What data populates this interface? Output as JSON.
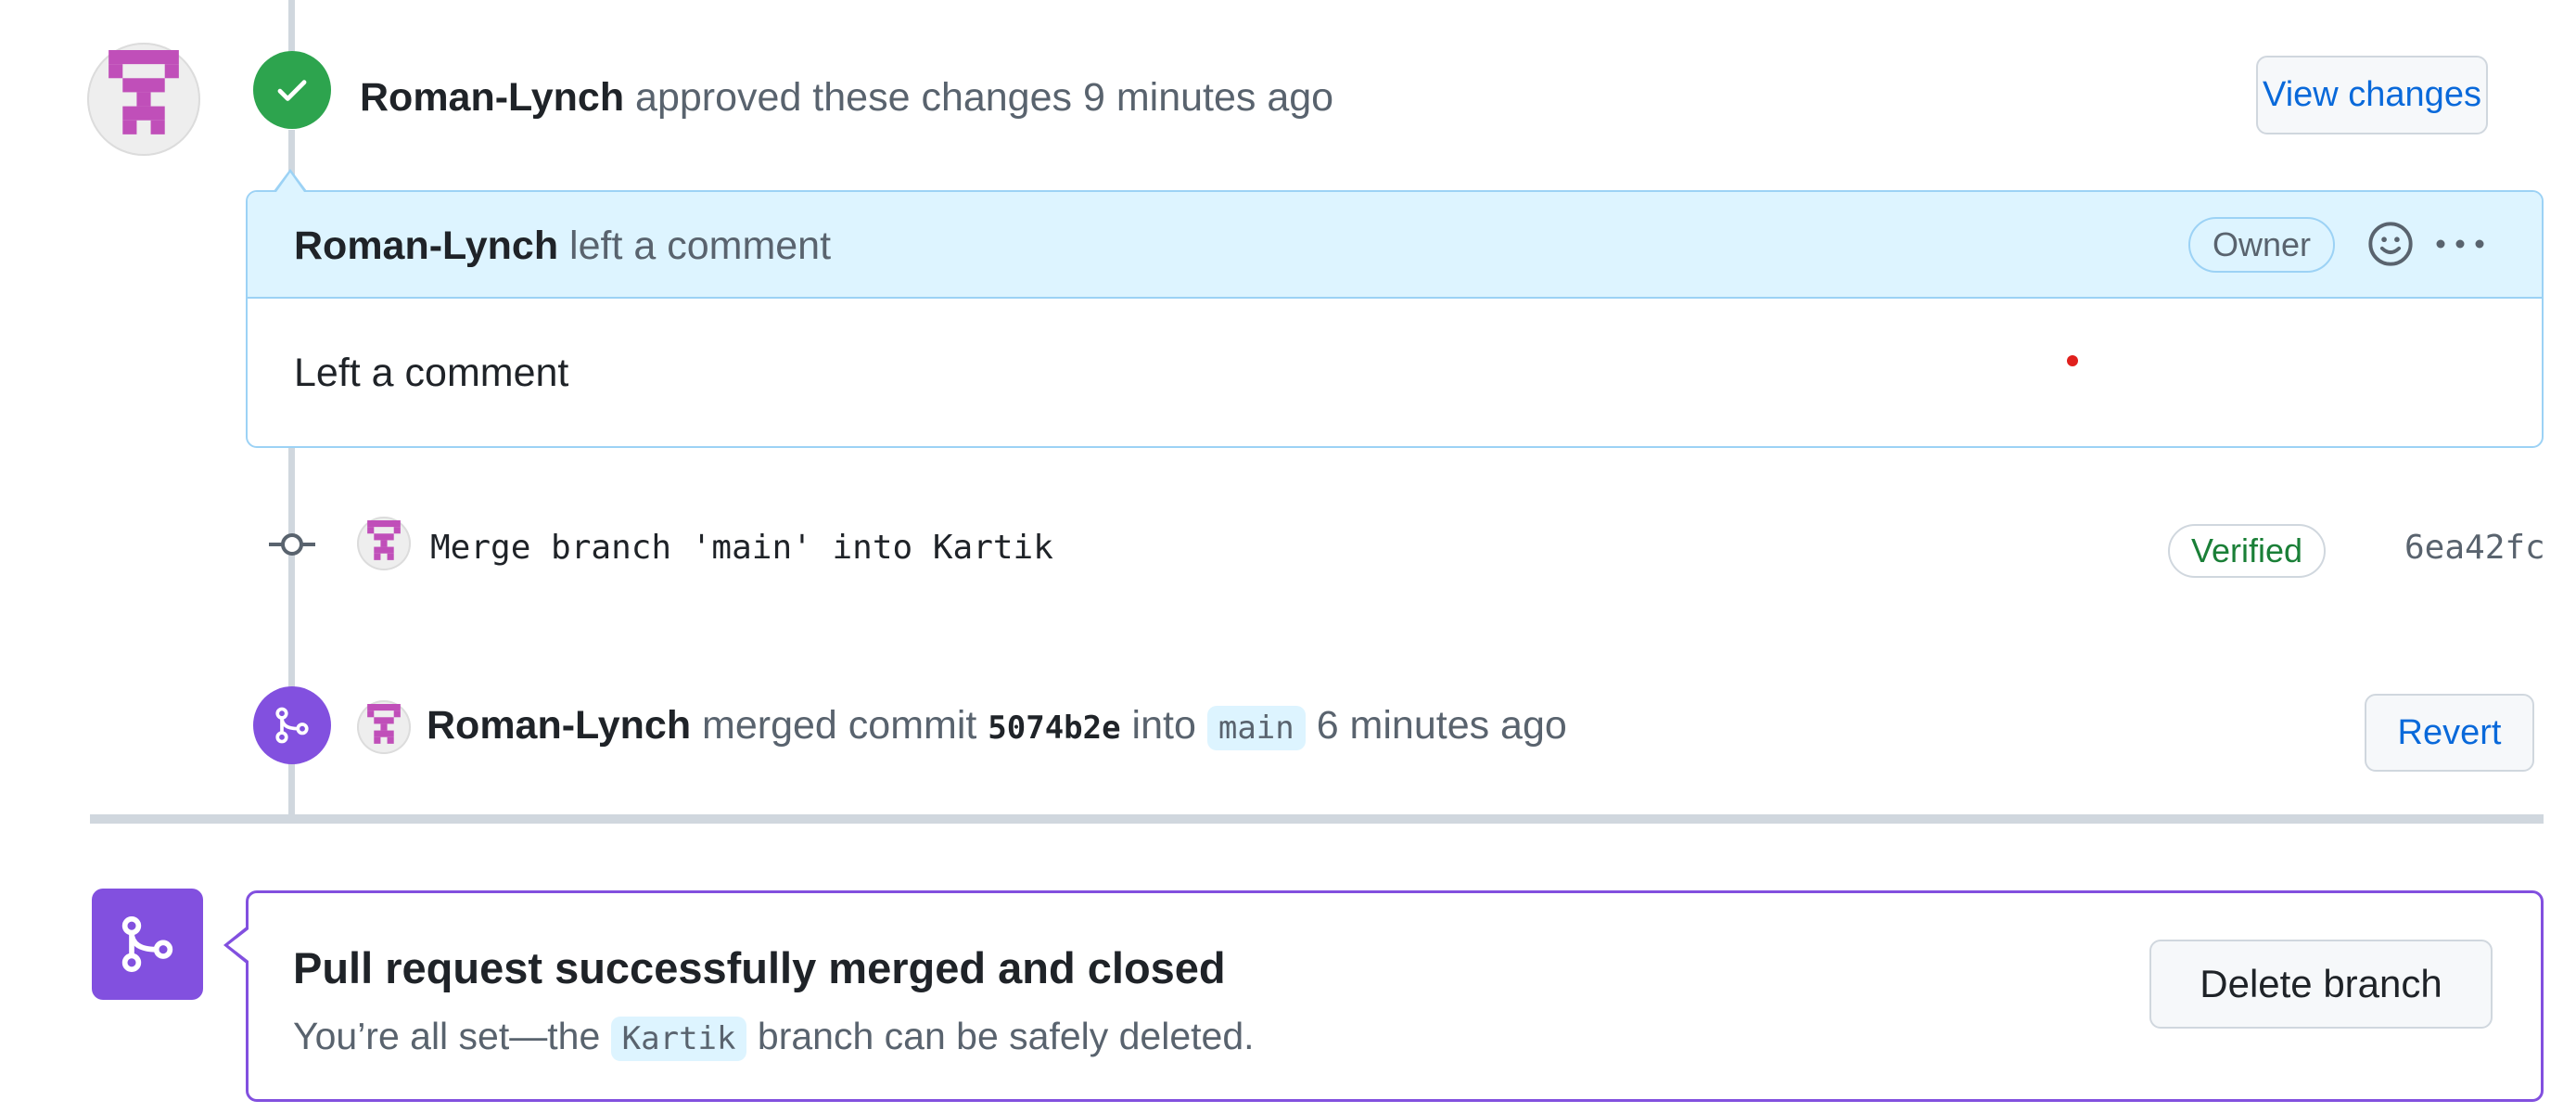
{
  "review": {
    "author": "Roman-Lynch",
    "action": "approved these changes",
    "time": "9 minutes ago",
    "view_changes_label": "View changes"
  },
  "comment": {
    "author": "Roman-Lynch",
    "action": "left a comment",
    "role_badge": "Owner",
    "body": "Left a comment"
  },
  "commit": {
    "message": "Merge branch 'main' into Kartik",
    "verified_label": "Verified",
    "sha": "6ea42fc"
  },
  "merge_event": {
    "author": "Roman-Lynch",
    "action": "merged commit",
    "sha": "5074b2e",
    "into_word": "into",
    "branch": "main",
    "time": "6 minutes ago",
    "revert_label": "Revert"
  },
  "merged_status": {
    "title": "Pull request successfully merged and closed",
    "desc_prefix": "You’re all set—the",
    "branch": "Kartik",
    "desc_suffix": "branch can be safely deleted.",
    "delete_label": "Delete branch"
  },
  "colors": {
    "approved_green": "#2da44e",
    "merged_purple": "#8250df",
    "link_blue": "#0969da",
    "identicon_pink": "#c04fb9"
  }
}
